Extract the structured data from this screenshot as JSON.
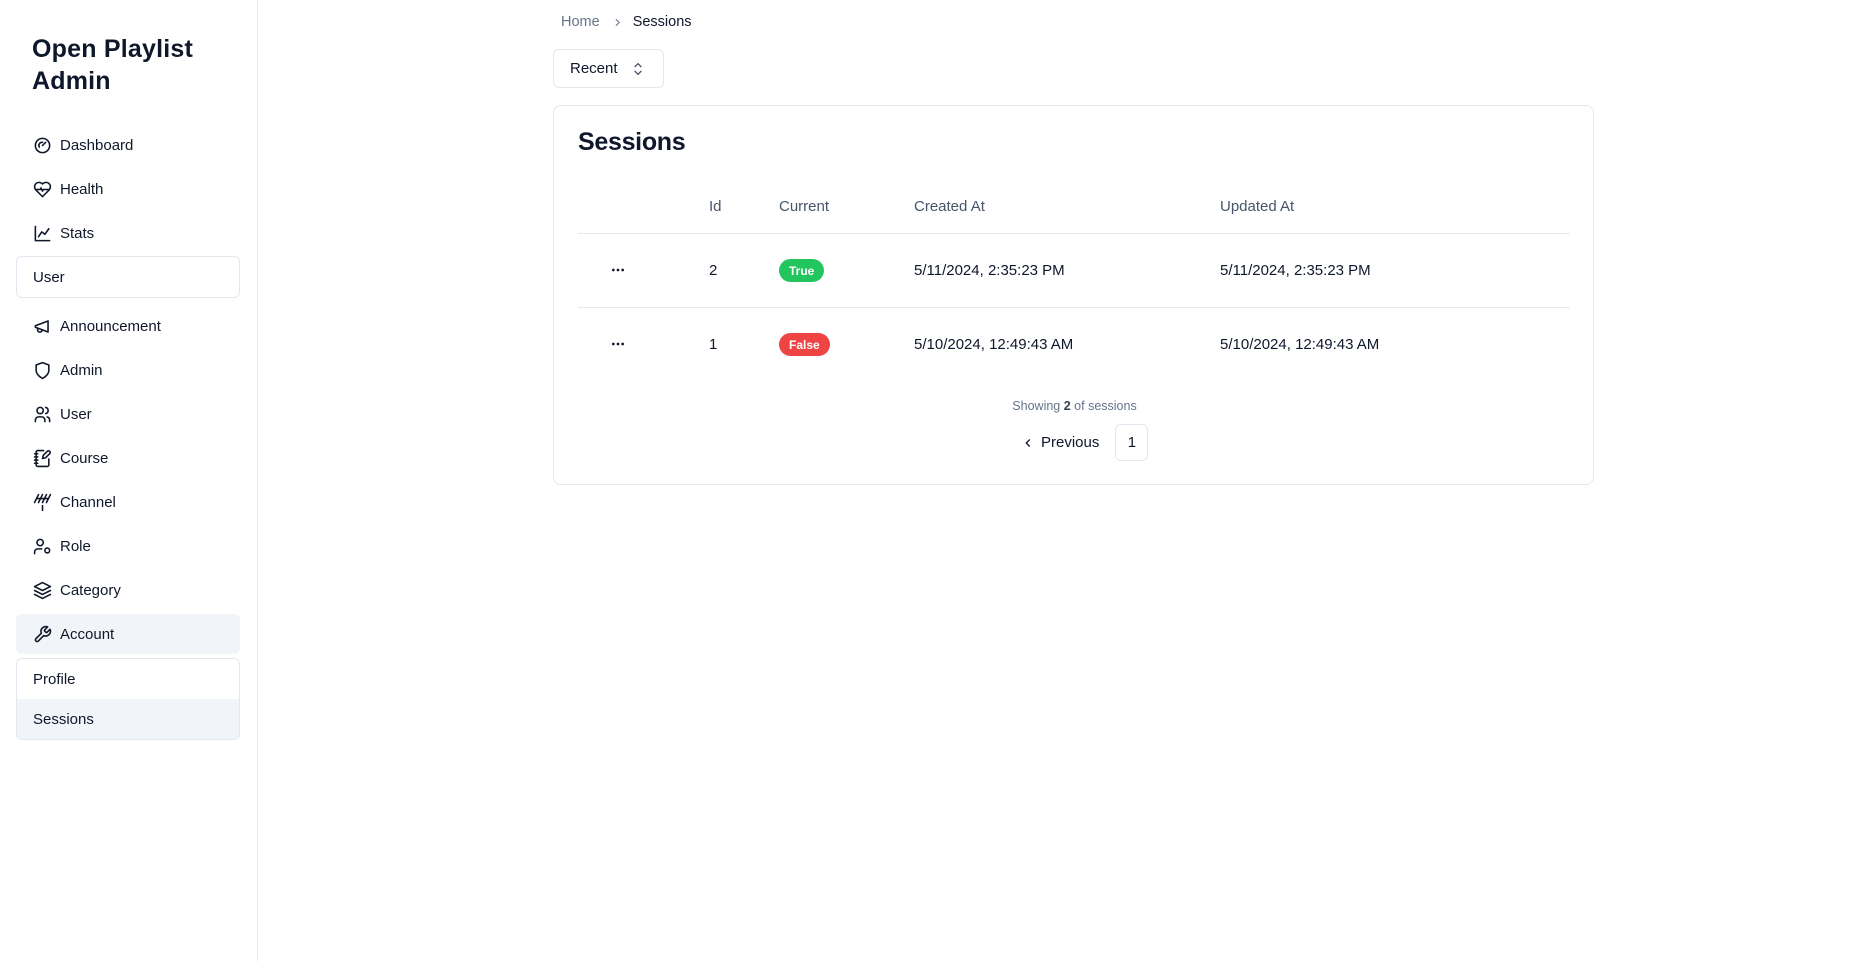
{
  "sidebar": {
    "brand": "Open Playlist Admin",
    "items": [
      {
        "label": "Dashboard",
        "icon": "gauge-icon"
      },
      {
        "label": "Health",
        "icon": "heart-pulse-icon"
      },
      {
        "label": "Stats",
        "icon": "line-chart-icon"
      },
      {
        "label": "User",
        "icon": ""
      },
      {
        "label": "Announcement",
        "icon": "megaphone-icon"
      },
      {
        "label": "Admin",
        "icon": "shield-icon"
      },
      {
        "label": "User",
        "icon": "users-icon"
      },
      {
        "label": "Course",
        "icon": "notebook-pen-icon"
      },
      {
        "label": "Channel",
        "icon": "antenna-icon"
      },
      {
        "label": "Role",
        "icon": "user-cog-icon"
      },
      {
        "label": "Category",
        "icon": "layers-icon"
      },
      {
        "label": "Account",
        "icon": "wrench-icon"
      }
    ],
    "account_sub": [
      {
        "label": "Profile"
      },
      {
        "label": "Sessions"
      }
    ]
  },
  "breadcrumb": {
    "home": "Home",
    "current": "Sessions"
  },
  "filter": {
    "selected": "Recent"
  },
  "sessions": {
    "title": "Sessions",
    "columns": [
      "",
      "Id",
      "Current",
      "Created At",
      "Updated At"
    ],
    "rows": [
      {
        "id": "2",
        "current": "True",
        "created_at": "5/11/2024, 2:35:23 PM",
        "updated_at": "5/11/2024, 2:35:23 PM"
      },
      {
        "id": "1",
        "current": "False",
        "created_at": "5/10/2024, 12:49:43 AM",
        "updated_at": "5/10/2024, 12:49:43 AM"
      }
    ],
    "footer": {
      "showing_prefix": "Showing",
      "count": "2",
      "showing_suffix": "of sessions",
      "previous_label": "Previous",
      "page": "1"
    }
  },
  "colors": {
    "true_badge": "#22c55e",
    "false_badge": "#ef4444",
    "active_bg": "#f1f5f9",
    "border": "#e2e8f0"
  }
}
